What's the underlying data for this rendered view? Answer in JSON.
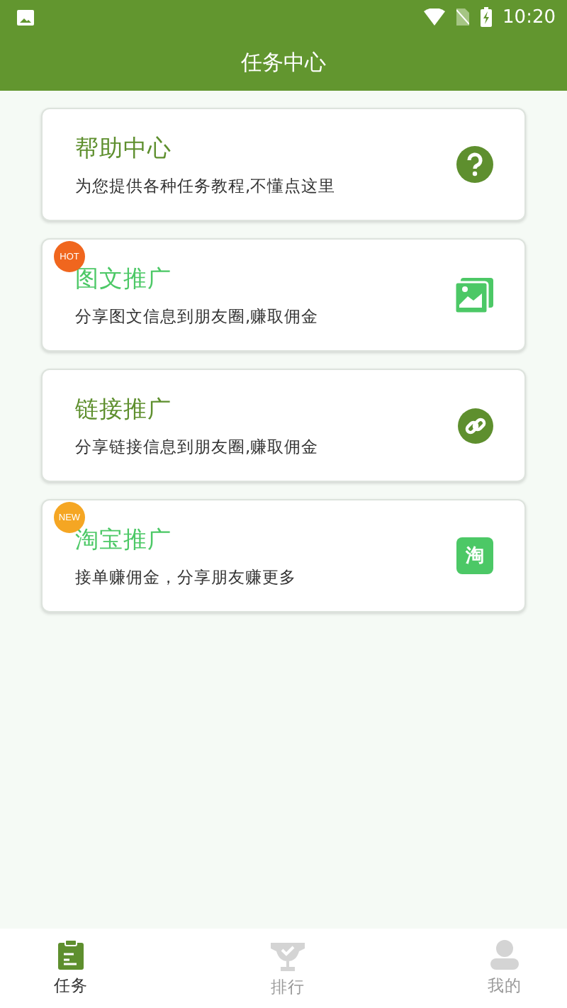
{
  "status_bar": {
    "time": "10:20"
  },
  "app_bar": {
    "title": "任务中心"
  },
  "cards": [
    {
      "title": "帮助中心",
      "subtitle": "为您提供各种任务教程,不懂点这里",
      "color": "#5e8f2e",
      "kind": "help"
    },
    {
      "title": "图文推广",
      "subtitle": "分享图文信息到朋友圈,赚取佣金",
      "color": "#4cc866",
      "kind": "image",
      "badge": {
        "kind": "hot",
        "text": "HOT"
      }
    },
    {
      "title": "链接推广",
      "subtitle": "分享链接信息到朋友圈,赚取佣金",
      "color": "#5e8f2e",
      "kind": "link"
    },
    {
      "title": "淘宝推广",
      "subtitle": "接单赚佣金，分享朋友赚更多",
      "color": "#4cc866",
      "kind": "taobao",
      "icon_text": "淘",
      "badge": {
        "kind": "new",
        "text": "NEW"
      }
    }
  ],
  "bottom_nav": [
    {
      "label": "任务",
      "kind": "task",
      "selected": true
    },
    {
      "label": "排行",
      "kind": "trophy",
      "selected": false
    },
    {
      "label": "我的",
      "kind": "person",
      "selected": false
    }
  ]
}
